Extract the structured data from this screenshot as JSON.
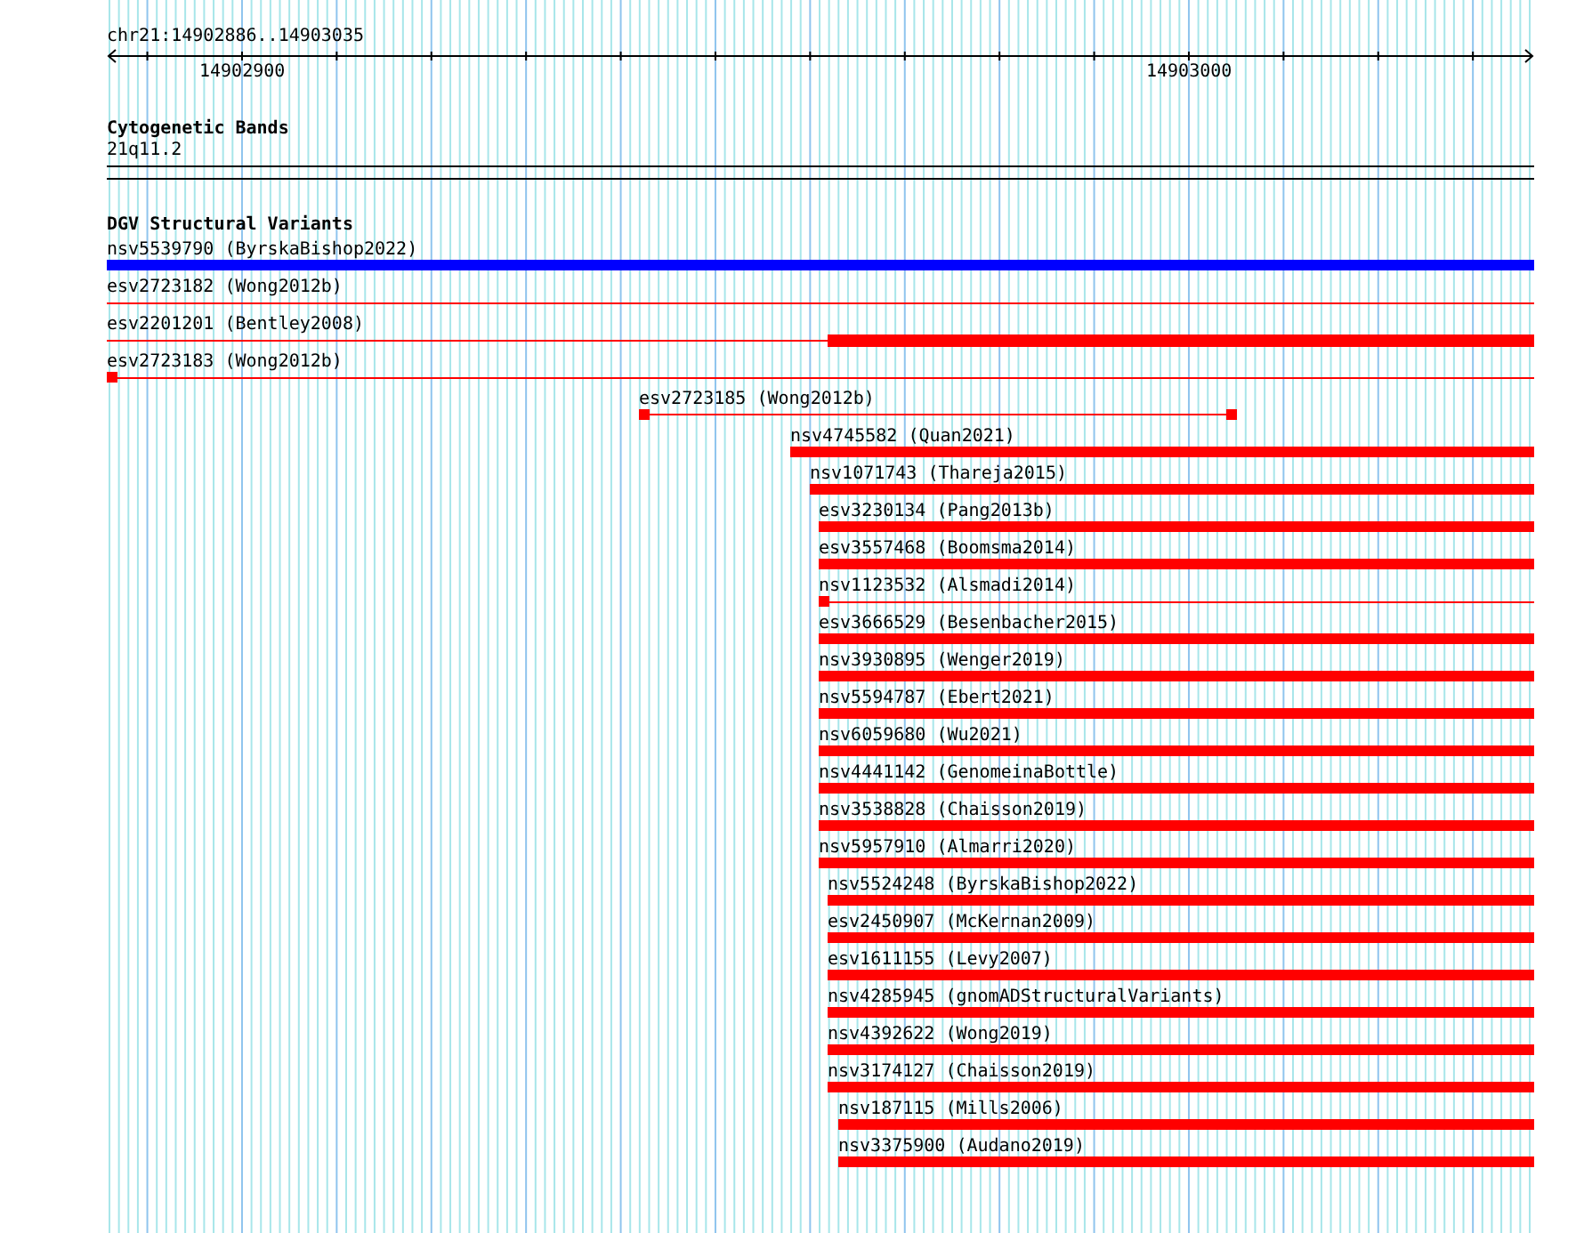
{
  "ruler": {
    "location": "chr21:14902886..14903035",
    "tick_labels": [
      "14902900",
      "14903000"
    ]
  },
  "cytogenetic_bands": {
    "title": "Cytogenetic Bands",
    "band": "21q11.2"
  },
  "dgv_track": {
    "title": "DGV Structural Variants",
    "features": [
      {
        "label": "nsv5539790 (ByrskaBishop2022)",
        "color": "#0000ff",
        "kind": "thick"
      },
      {
        "label": "esv2723182 (Wong2012b)",
        "color": "#ff0000",
        "kind": "thin"
      },
      {
        "label": "esv2201201 (Bentley2008)",
        "color": "#ff0000",
        "kind": "thin_thick_end"
      },
      {
        "label": "esv2723183 (Wong2012b)",
        "color": "#ff0000",
        "kind": "stub"
      },
      {
        "label": "esv2723185 (Wong2012b)",
        "color": "#ff0000",
        "kind": "dumbbell"
      },
      {
        "label": "nsv4745582 (Quan2021)",
        "color": "#ff0000",
        "kind": "thick"
      },
      {
        "label": "nsv1071743 (Thareja2015)",
        "color": "#ff0000",
        "kind": "thick"
      },
      {
        "label": "esv3230134 (Pang2013b)",
        "color": "#ff0000",
        "kind": "thick"
      },
      {
        "label": "esv3557468 (Boomsma2014)",
        "color": "#ff0000",
        "kind": "thick"
      },
      {
        "label": "nsv1123532 (Alsmadi2014)",
        "color": "#ff0000",
        "kind": "stub"
      },
      {
        "label": "esv3666529 (Besenbacher2015)",
        "color": "#ff0000",
        "kind": "thick"
      },
      {
        "label": "nsv3930895 (Wenger2019)",
        "color": "#ff0000",
        "kind": "thick"
      },
      {
        "label": "nsv5594787 (Ebert2021)",
        "color": "#ff0000",
        "kind": "thick"
      },
      {
        "label": "nsv6059680 (Wu2021)",
        "color": "#ff0000",
        "kind": "thick"
      },
      {
        "label": "nsv4441142 (GenomeinaBottle)",
        "color": "#ff0000",
        "kind": "thick"
      },
      {
        "label": "nsv3538828 (Chaisson2019)",
        "color": "#ff0000",
        "kind": "thick"
      },
      {
        "label": "nsv5957910 (Almarri2020)",
        "color": "#ff0000",
        "kind": "thick"
      },
      {
        "label": "nsv5524248 (ByrskaBishop2022)",
        "color": "#ff0000",
        "kind": "thick"
      },
      {
        "label": "esv2450907 (McKernan2009)",
        "color": "#ff0000",
        "kind": "thick"
      },
      {
        "label": "esv1611155 (Levy2007)",
        "color": "#ff0000",
        "kind": "thick"
      },
      {
        "label": "nsv4285945 (gnomADStructuralVariants)",
        "color": "#ff0000",
        "kind": "thick"
      },
      {
        "label": "nsv4392622 (Wong2019)",
        "color": "#ff0000",
        "kind": "thick"
      },
      {
        "label": "nsv3174127 (Chaisson2019)",
        "color": "#ff0000",
        "kind": "thick"
      },
      {
        "label": "nsv187115 (Mills2006)",
        "color": "#ff0000",
        "kind": "thick"
      },
      {
        "label": "nsv3375900 (Audano2019)",
        "color": "#ff0000",
        "kind": "thick"
      }
    ]
  }
}
